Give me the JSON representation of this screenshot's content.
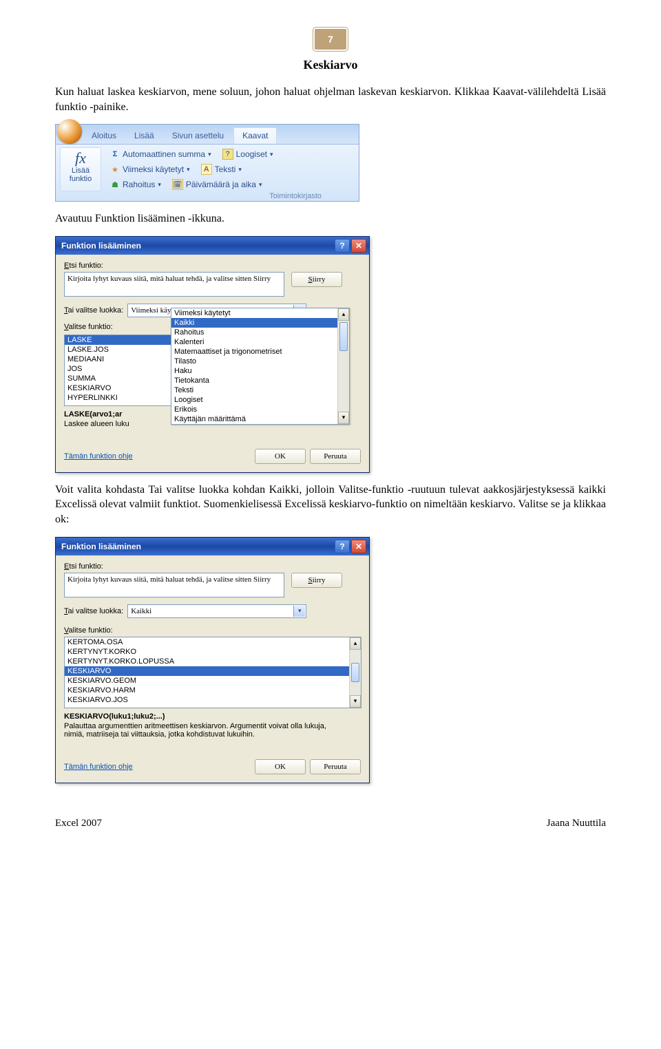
{
  "page": {
    "badge": "7",
    "heading": "Keskiarvo"
  },
  "para1": "Kun haluat laskea keskiarvon, mene soluun, johon haluat ohjelman laskevan keskiarvon. Klikkaa Kaavat-välilehdeltä Lisää funktio -painike.",
  "para2": "Avautuu  Funktion lisääminen -ikkuna.",
  "para3": "Voit valita kohdasta Tai valitse luokka kohdan Kaikki, jolloin Valitse-funktio -ruutuun tulevat aakkosjärjestyksessä kaikki Excelissä olevat valmiit funktiot. Suomenkielisessä Excelissä keskiarvo-funktio on nimeltään keskiarvo. Valitse se ja klikkaa ok:",
  "footer": {
    "left": "Excel 2007",
    "right": "Jaana Nuuttila"
  },
  "ribbon": {
    "tabs": {
      "home": "Aloitus",
      "insert": "Lisää",
      "pagelayout": "Sivun asettelu",
      "formulas": "Kaavat"
    },
    "insertFunction": {
      "line1": "Lisää",
      "line2": "funktio"
    },
    "buttons": {
      "autosum": "Automaattinen summa",
      "recent": "Viimeksi käytetyt",
      "financial": "Rahoitus",
      "logical": "Loogiset",
      "text": "Teksti",
      "datetime": "Päivämäärä ja aika"
    },
    "groupLabel": "Toimintokirjasto"
  },
  "dialog": {
    "title": "Funktion lisääminen",
    "searchLabel": "Etsi funktio:",
    "searchText": "Kirjoita lyhyt kuvaus siitä, mitä haluat tehdä, ja valitse sitten Siirry",
    "goBtn": "Siirry",
    "categoryLabel": "Tai valitse luokka:",
    "selectFuncLabel": "Valitse funktio:",
    "helpLink": "Tämän funktion ohje",
    "okBtn": "OK",
    "cancelBtn": "Peruuta"
  },
  "dialog1": {
    "categorySelected": "Viimeksi käytetyt",
    "funcList": [
      "LASKE",
      "LASKE.JOS",
      "MEDIAANI",
      "JOS",
      "SUMMA",
      "KESKIARVO",
      "HYPERLINKKI"
    ],
    "signature": "LASKE(arvo1;ar",
    "desc": "Laskee alueen luku",
    "categories": [
      "Viimeksi käytetyt",
      "Kaikki",
      "Rahoitus",
      "Kalenteri",
      "Matemaattiset ja trigonometriset",
      "Tilasto",
      "Haku",
      "Tietokanta",
      "Teksti",
      "Loogiset",
      "Erikois",
      "Käyttäjän määrittämä"
    ],
    "catSelectedIndex": 1
  },
  "dialog2": {
    "categorySelected": "Kaikki",
    "funcList": [
      "KERTOMA.OSA",
      "KERTYNYT.KORKO",
      "KERTYNYT.KORKO.LOPUSSA",
      "KESKIARVO",
      "KESKIARVO.GEOM",
      "KESKIARVO.HARM",
      "KESKIARVO.JOS"
    ],
    "selectedIndex": 3,
    "signature": "KESKIARVO(luku1;luku2;...)",
    "desc": "Palauttaa argumenttien aritmeettisen keskiarvon. Argumentit voivat olla lukuja, nimiä, matriiseja tai viittauksia, jotka kohdistuvat lukuihin."
  }
}
